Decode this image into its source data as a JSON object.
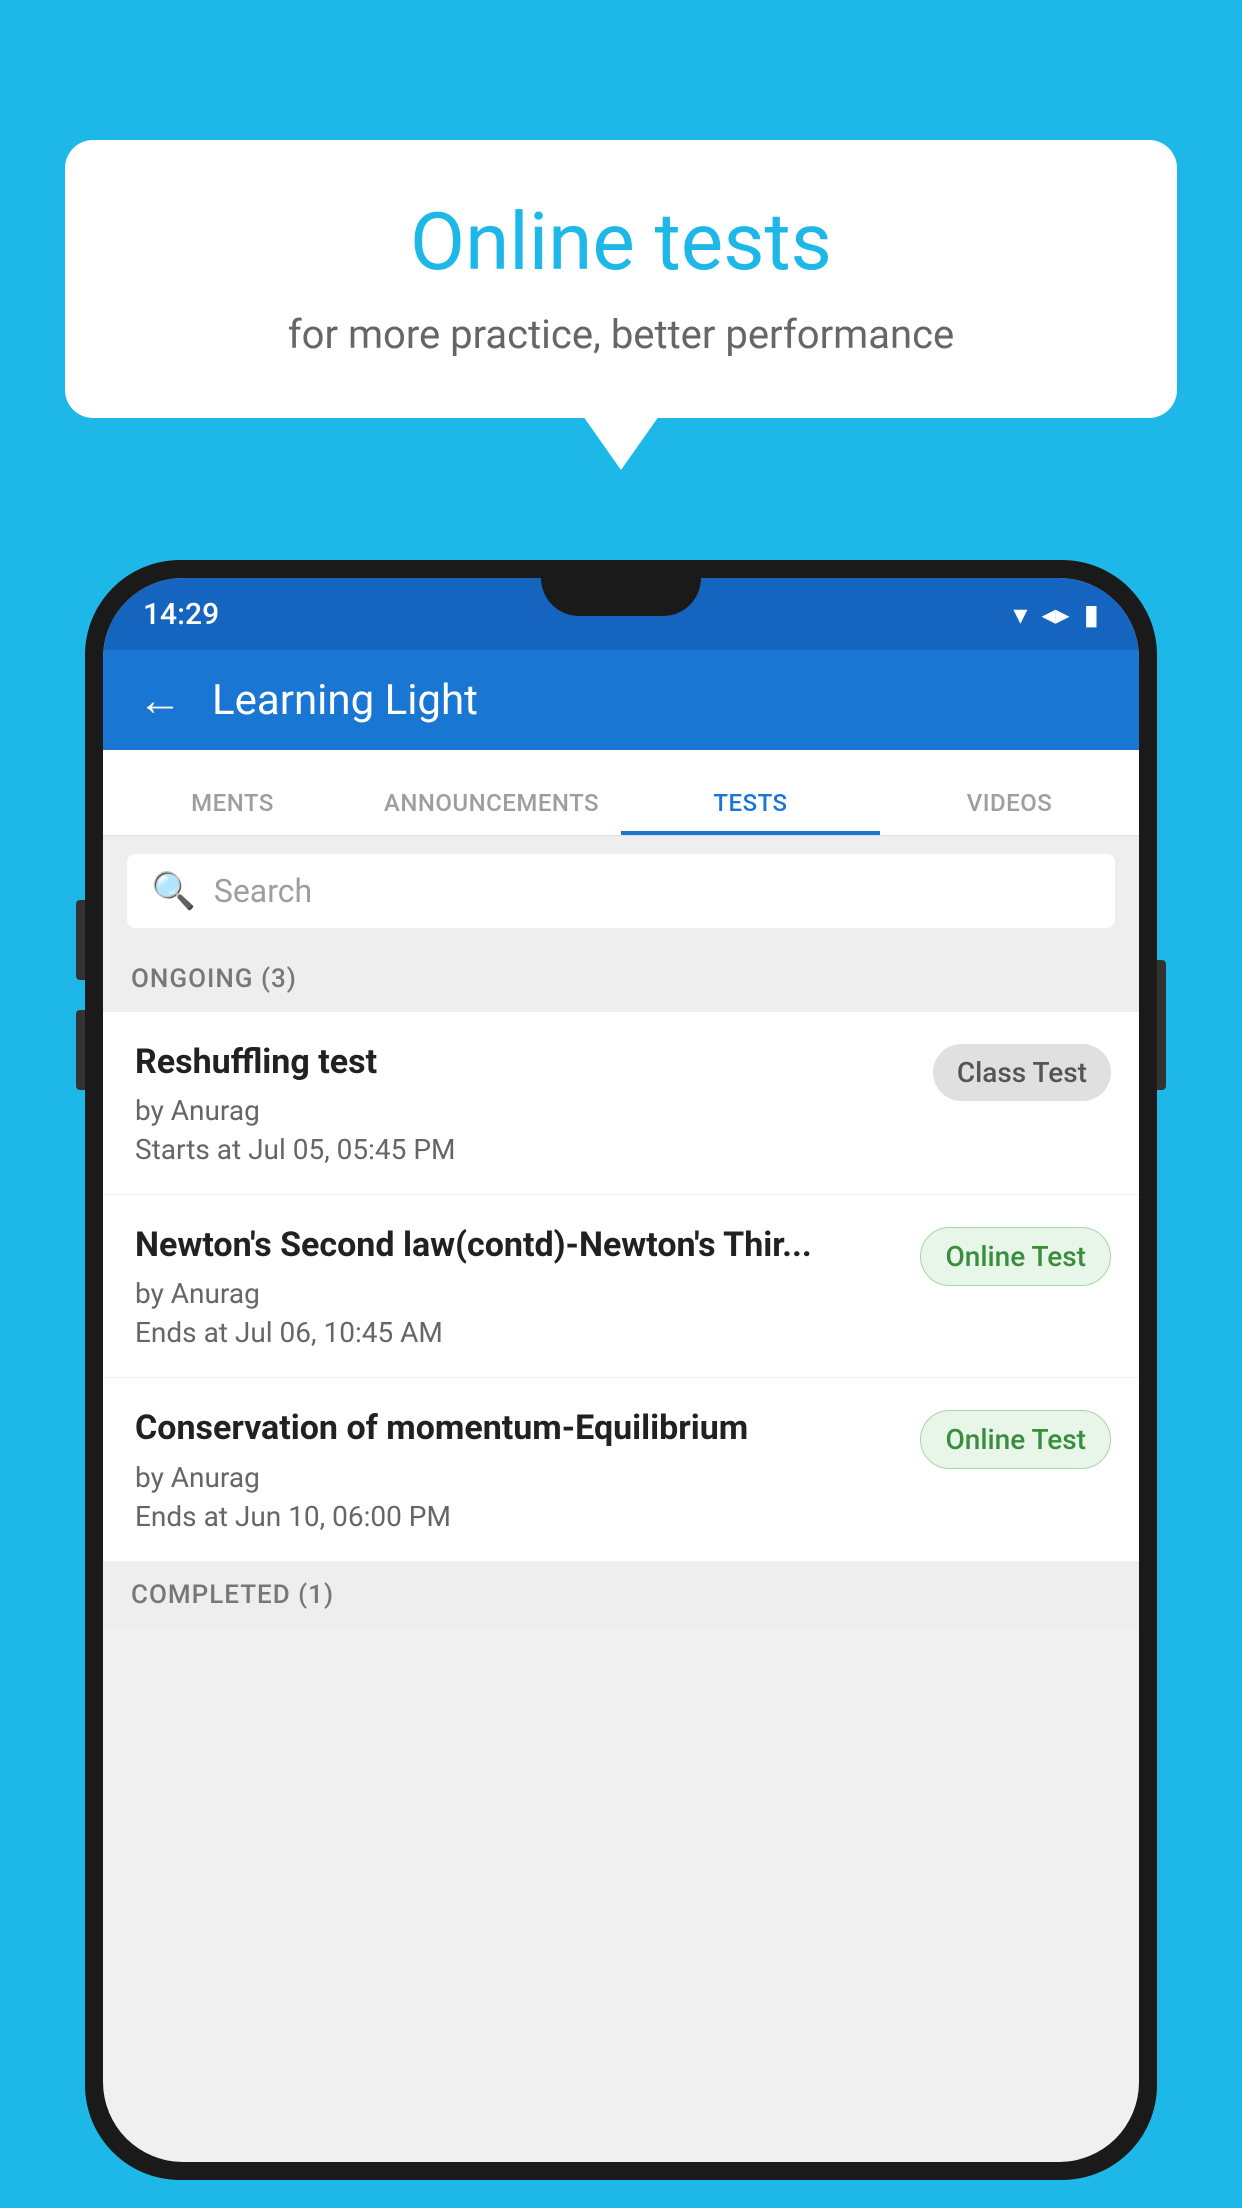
{
  "background_color": "#1DB8E8",
  "bubble": {
    "title": "Online tests",
    "subtitle": "for more practice, better performance"
  },
  "status_bar": {
    "time": "14:29",
    "wifi_icon": "▾",
    "signal_icon": "▲",
    "battery_icon": "▮"
  },
  "app_bar": {
    "back_label": "←",
    "title": "Learning Light"
  },
  "tabs": [
    {
      "label": "MENTS",
      "active": false
    },
    {
      "label": "ANNOUNCEMENTS",
      "active": false
    },
    {
      "label": "TESTS",
      "active": true
    },
    {
      "label": "VIDEOS",
      "active": false
    }
  ],
  "search": {
    "placeholder": "Search",
    "icon": "🔍"
  },
  "ongoing_section": {
    "header": "ONGOING (3)"
  },
  "tests": [
    {
      "title": "Reshuffling test",
      "author": "by Anurag",
      "date": "Starts at  Jul 05, 05:45 PM",
      "badge": "Class Test",
      "badge_type": "class"
    },
    {
      "title": "Newton's Second law(contd)-Newton's Thir...",
      "author": "by Anurag",
      "date": "Ends at  Jul 06, 10:45 AM",
      "badge": "Online Test",
      "badge_type": "online"
    },
    {
      "title": "Conservation of momentum-Equilibrium",
      "author": "by Anurag",
      "date": "Ends at  Jun 10, 06:00 PM",
      "badge": "Online Test",
      "badge_type": "online"
    }
  ],
  "completed_section": {
    "header": "COMPLETED (1)"
  }
}
